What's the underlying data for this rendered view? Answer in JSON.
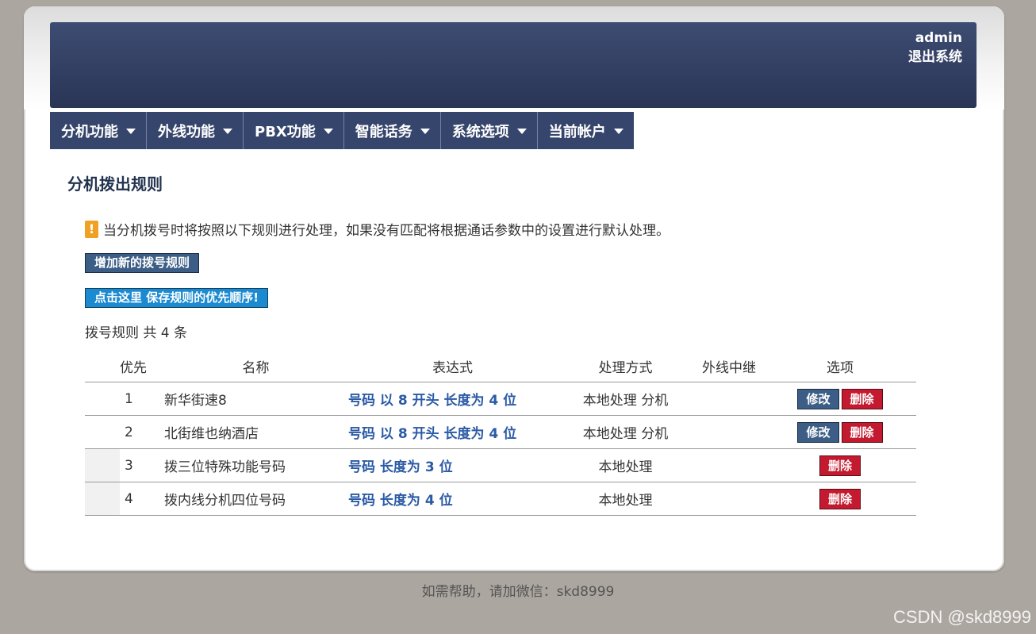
{
  "header": {
    "username": "admin",
    "logout_label": "退出系统"
  },
  "nav": {
    "items": [
      {
        "label": "分机功能"
      },
      {
        "label": "外线功能"
      },
      {
        "label": "PBX功能"
      },
      {
        "label": "智能话务"
      },
      {
        "label": "系统选项"
      },
      {
        "label": "当前帐户"
      }
    ]
  },
  "main": {
    "title": "分机拨出规则",
    "notice": "当分机拨号时将按照以下规则进行处理，如果没有匹配将根据通话参数中的设置进行默认处理。",
    "notice_icon": "!",
    "add_button": "增加新的拨号规则",
    "save_order_button": "点击这里 保存规则的优先顺序!",
    "count_text": "拨号规则 共 4 条"
  },
  "table": {
    "headers": {
      "priority": "优先",
      "name": "名称",
      "expression": "表达式",
      "method": "处理方式",
      "trunk": "外线中继",
      "options": "选项"
    },
    "rows": [
      {
        "priority": "1",
        "name": "新华街速8",
        "expression": "号码 以 8 开头 长度为 4 位",
        "method": "本地处理 分机",
        "trunk": "",
        "edit": "修改",
        "delete": "删除"
      },
      {
        "priority": "2",
        "name": "北街维也纳酒店",
        "expression": "号码 以 8 开头 长度为 4 位",
        "method": "本地处理 分机",
        "trunk": "",
        "edit": "修改",
        "delete": "删除"
      },
      {
        "priority": "3",
        "name": "拨三位特殊功能号码",
        "expression": "号码 长度为 3 位",
        "method": "本地处理",
        "trunk": "",
        "delete": "删除"
      },
      {
        "priority": "4",
        "name": "拨内线分机四位号码",
        "expression": "号码 长度为 4 位",
        "method": "本地处理",
        "trunk": "",
        "delete": "删除"
      }
    ]
  },
  "footer": "如需帮助，请加微信：skd8999",
  "watermark": "CSDN @skd8999",
  "colors": {
    "header_bg": "#2f3b5f",
    "nav_bg": "#36456b",
    "edit_button": "#3c5e86",
    "delete_button": "#c31a2f",
    "save_button": "#1b8ad0",
    "expression_text": "#2b5aa6",
    "page_bg": "#aba69f"
  }
}
